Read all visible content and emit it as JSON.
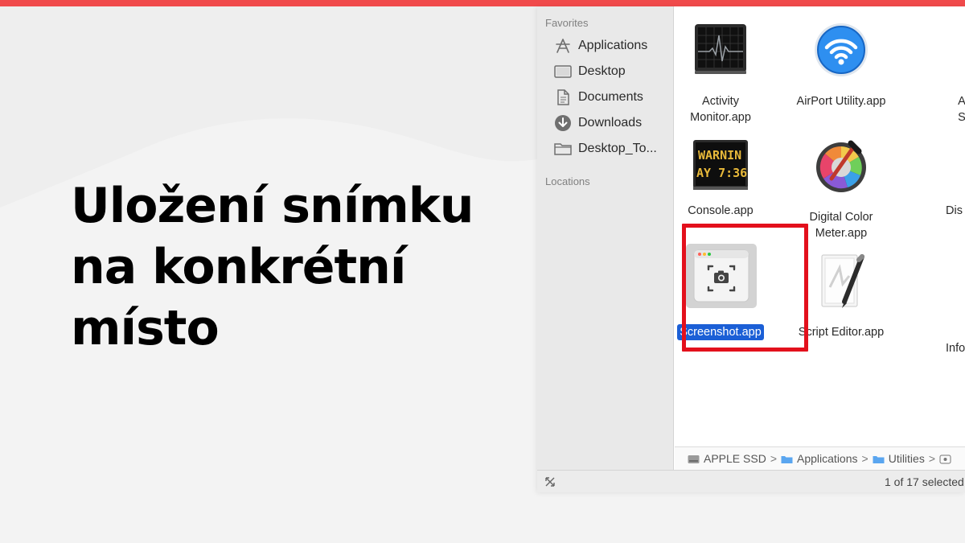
{
  "headline": {
    "line1": "Uložení snímku",
    "line2": "na konkrétní",
    "line3": "místo"
  },
  "colors": {
    "accent_bar": "#f04a4b",
    "highlight_box": "#e3101c",
    "selection": "#1b5fd6"
  },
  "finder": {
    "sidebar": {
      "favorites_heading": "Favorites",
      "favorites": [
        {
          "label": "Applications",
          "icon": "applications-icon"
        },
        {
          "label": "Desktop",
          "icon": "desktop-icon"
        },
        {
          "label": "Documents",
          "icon": "documents-icon"
        },
        {
          "label": "Downloads",
          "icon": "downloads-icon"
        },
        {
          "label": "Desktop_To...",
          "icon": "folder-icon"
        }
      ],
      "locations_heading": "Locations"
    },
    "files": [
      {
        "line1": "Activity",
        "line2": "Monitor.app",
        "icon": "activity-monitor-icon"
      },
      {
        "line1": "AirPort Utility.app",
        "line2": "",
        "icon": "airport-utility-icon"
      },
      {
        "line1": "A",
        "line2": "S",
        "icon": "partial-app-icon"
      },
      {
        "line1": "Console.app",
        "line2": "",
        "icon": "console-icon",
        "console_text1": "WARNIN",
        "console_text2": "AY 7:36"
      },
      {
        "line1": "Digital Color",
        "line2": "Meter.app",
        "icon": "digital-color-meter-icon"
      },
      {
        "line1": "Dis",
        "line2": "",
        "icon": "partial-app-icon"
      },
      {
        "line1": "Screenshot.app",
        "line2": "",
        "icon": "screenshot-icon",
        "selected": true
      },
      {
        "line1": "Script Editor.app",
        "line2": "",
        "icon": "script-editor-icon"
      },
      {
        "line1": "Info",
        "line2": "",
        "icon": "partial-app-icon"
      }
    ],
    "pathbar": {
      "items": [
        "APPLE SSD",
        "Applications",
        "Utilities"
      ],
      "separator": ">"
    },
    "status": "1 of 17 selected"
  }
}
